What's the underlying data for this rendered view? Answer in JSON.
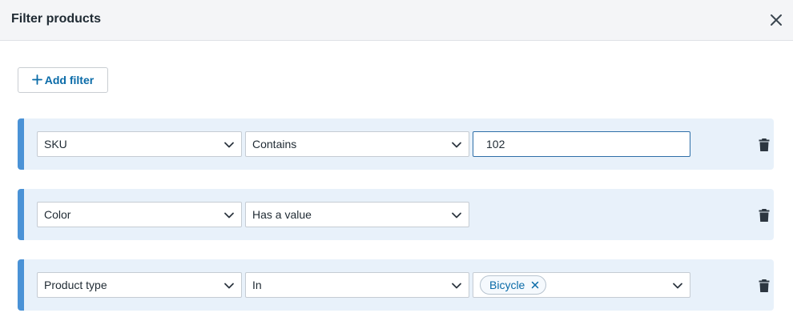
{
  "dialog": {
    "title": "Filter products",
    "close_icon": "close-icon"
  },
  "add_filter": {
    "icon": "plus-icon",
    "label": "Add filter"
  },
  "colors": {
    "accent": "#0a6ba8",
    "row_bg": "#e8f1fa",
    "row_stripe": "#4a92d6"
  },
  "filters": [
    {
      "field": "SKU",
      "operator": "Contains",
      "value": "102",
      "value_type": "text"
    },
    {
      "field": "Color",
      "operator": "Has a value",
      "value_type": "none"
    },
    {
      "field": "Product type",
      "operator": "In",
      "value_type": "multiselect",
      "chips": [
        "Bicycle"
      ]
    }
  ]
}
